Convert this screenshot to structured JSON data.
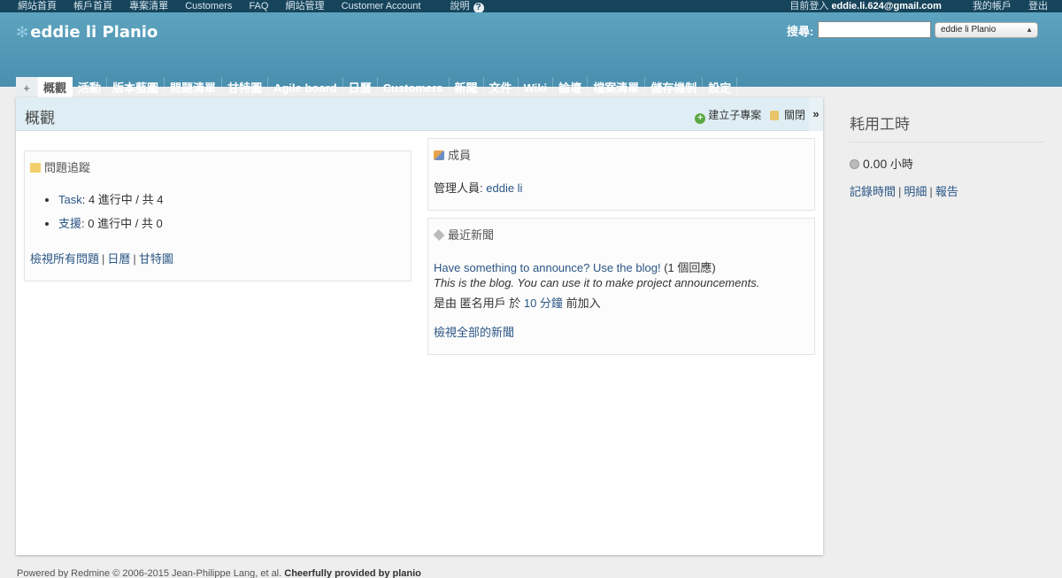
{
  "top_menu": {
    "items": [
      "網站首頁",
      "帳戶首頁",
      "專案清單",
      "Customers",
      "FAQ",
      "網站管理",
      "Customer Account",
      "說明"
    ],
    "help_icon": "?",
    "logged_as_label": "目前登入",
    "logged_as_user": "eddie.li.624@gmail.com",
    "my_account": "我的帳戶",
    "logout": "登出"
  },
  "header": {
    "project_title": "eddie li Planio",
    "search_label": "搜尋:",
    "search_value": "",
    "project_jump": "eddie li Planio"
  },
  "tabs": {
    "plus": "+",
    "items": [
      "概觀",
      "活動",
      "版本藍圖",
      "問題清單",
      "甘特圖",
      "Agile board",
      "日曆",
      "Customers",
      "新聞",
      "文件",
      "Wiki",
      "論壇",
      "檔案清單",
      "儲存機制",
      "設定"
    ],
    "selected_index": 0
  },
  "content": {
    "title": "概觀",
    "new_subproject": "建立子專案",
    "close": "關閉",
    "sidebar_toggle": "»"
  },
  "issues_box": {
    "title": "問題追蹤",
    "trackers": [
      {
        "name": "Task",
        "text": ": 4 進行中 / 共 4"
      },
      {
        "name": "支援",
        "text": ": 0 進行中 / 共 0"
      }
    ],
    "links": [
      "檢視所有問題",
      "日曆",
      "甘特圖"
    ],
    "separator": "|"
  },
  "members_box": {
    "title": "成員",
    "manager_label": "管理人員:",
    "manager_name": "eddie li"
  },
  "news_box": {
    "title": "最近新聞",
    "news_title": "Have something to announce? Use the blog!",
    "news_comments": "(1 個回應)",
    "news_summary": "This is the blog. You can use it to make project announcements.",
    "author_prefix": "是由 匿名用戶 於",
    "time_ago": "10 分鐘",
    "author_suffix": "前加入",
    "view_all": "檢視全部的新聞"
  },
  "sidebar": {
    "title": "耗用工時",
    "hours": "0.00",
    "hours_unit": "小時",
    "links": [
      "記錄時間",
      "明細",
      "報告"
    ],
    "separator": "|"
  },
  "footer": {
    "text": "Powered by Redmine © 2006-2015 Jean-Philippe Lang, et al.",
    "provided": "Cheerfully provided by",
    "brand": "planio"
  },
  "colors": {
    "top_bar": "#16445b",
    "header": "#5da3bf",
    "link": "#2a5685",
    "content_head": "#dfeef5"
  }
}
